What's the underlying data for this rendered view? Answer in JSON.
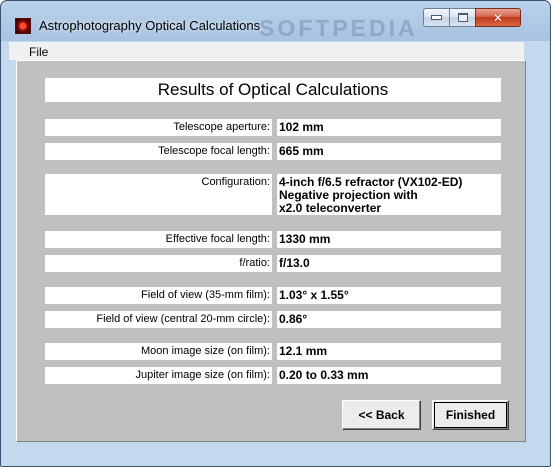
{
  "window": {
    "title": "Astrophotography Optical Calculations",
    "watermark": "SOFTPEDIA"
  },
  "menu": {
    "file_label": "File"
  },
  "results": {
    "heading": "Results of Optical Calculations",
    "rows": [
      {
        "label": "Telescope aperture:",
        "value": "102 mm"
      },
      {
        "label": "Telescope focal length:",
        "value": "665 mm"
      },
      {
        "label": "Configuration:",
        "value_lines": [
          "4-inch f/6.5 refractor (VX102-ED)",
          "Negative projection with",
          "x2.0 teleconverter"
        ]
      },
      {
        "label": "Effective focal length:",
        "value": "1330 mm"
      },
      {
        "label": "f/ratio:",
        "value": "f/13.0"
      },
      {
        "label": "Field of view (35-mm film):",
        "value": "1.03° x 1.55°"
      },
      {
        "label": "Field of view (central 20-mm circle):",
        "value": "0.86°"
      },
      {
        "label": "Moon image size (on film):",
        "value": "12.1 mm"
      },
      {
        "label": "Jupiter image size (on film):",
        "value": "0.20 to 0.33 mm"
      }
    ]
  },
  "buttons": {
    "back_label": "<< Back",
    "finished_label": "Finished"
  },
  "colors": {
    "titlebar": "#b9d1ea",
    "client_bg": "#c0c0c0",
    "field_bg": "#ffffff",
    "close_button": "#c1391d"
  }
}
